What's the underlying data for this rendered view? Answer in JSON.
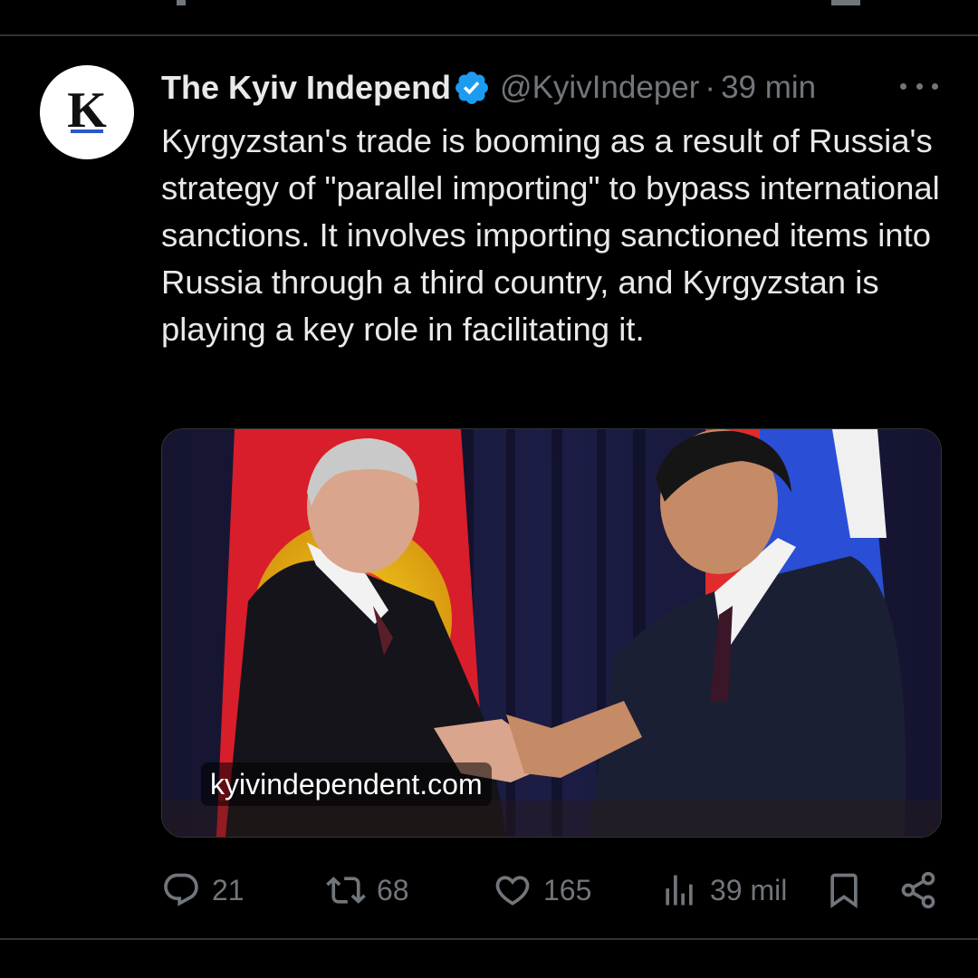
{
  "tweet": {
    "author_name": "The Kyiv Independ",
    "handle": "@KyivIndeper",
    "separator": "·",
    "time": "39 min",
    "avatar_letter": "K",
    "text": "Kyrgyzstan's trade is booming as a result of Russia's strategy of \"parallel importing\" to bypass international sanctions. It involves importing sanctioned items into Russia through a third country, and Kyrgyzstan is playing a key role in facilitating it.",
    "media_domain": "kyivindependent.com",
    "actions": {
      "replies": "21",
      "reposts": "68",
      "likes": "165",
      "views": "39 mil"
    }
  },
  "colors": {
    "background": "#000000",
    "text_primary": "#e7e9ea",
    "text_secondary": "#71767b",
    "verified_badge": "#1d9bf0",
    "divider": "#2f3336"
  },
  "icons": [
    "verified-badge-icon",
    "more-icon",
    "reply-icon",
    "repost-icon",
    "like-icon",
    "views-icon",
    "bookmark-icon",
    "share-icon"
  ]
}
